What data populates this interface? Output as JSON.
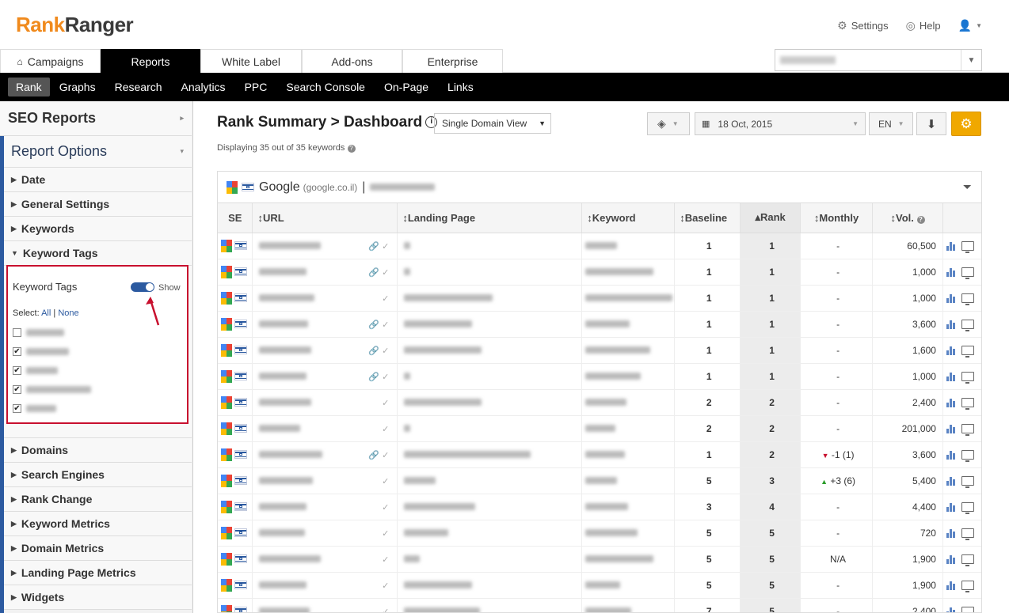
{
  "app": {
    "logo_part1": "Rank",
    "logo_part2": "Ranger",
    "settings": "Settings",
    "help": "Help"
  },
  "tabs": [
    "Campaigns",
    "Reports",
    "White Label",
    "Add-ons",
    "Enterprise"
  ],
  "subnav": [
    "Rank",
    "Graphs",
    "Research",
    "Analytics",
    "PPC",
    "Search Console",
    "On-Page",
    "Links"
  ],
  "sidebar": {
    "seo_reports": "SEO Reports",
    "report_options": "Report Options",
    "options_top": [
      "Date",
      "General Settings",
      "Keywords",
      "Keyword Tags"
    ],
    "keyword_tags_panel": {
      "label": "Keyword Tags",
      "toggle_label": "Show",
      "select_label": "Select:",
      "all": "All",
      "none": "None",
      "checkboxes": [
        {
          "checked": false,
          "w": 48
        },
        {
          "checked": true,
          "w": 54
        },
        {
          "checked": true,
          "w": 40
        },
        {
          "checked": true,
          "w": 82
        },
        {
          "checked": true,
          "w": 38
        }
      ]
    },
    "options_bottom": [
      "Domains",
      "Search Engines",
      "Rank Change",
      "Keyword Metrics",
      "Domain Metrics",
      "Landing Page Metrics",
      "Widgets"
    ]
  },
  "main": {
    "title": "Rank Summary > Dashboard",
    "view_select": "Single Domain View",
    "displaying": "Displaying 35 out of 35 keywords",
    "date": "18 Oct, 2015",
    "lang": "EN",
    "engine": "Google",
    "engine_domain": "(google.co.il)",
    "columns": [
      "SE",
      "URL",
      "Landing Page",
      "Keyword",
      "Baseline",
      "Rank",
      "Monthly",
      "Vol."
    ],
    "rows": [
      {
        "baseline": "1",
        "rank": "1",
        "monthly": "-",
        "vol": "60,500",
        "link": true
      },
      {
        "baseline": "1",
        "rank": "1",
        "monthly": "-",
        "vol": "1,000",
        "link": true
      },
      {
        "baseline": "1",
        "rank": "1",
        "monthly": "-",
        "vol": "1,000",
        "link": false
      },
      {
        "baseline": "1",
        "rank": "1",
        "monthly": "-",
        "vol": "3,600",
        "link": true
      },
      {
        "baseline": "1",
        "rank": "1",
        "monthly": "-",
        "vol": "1,600",
        "link": true
      },
      {
        "baseline": "1",
        "rank": "1",
        "monthly": "-",
        "vol": "1,000",
        "link": true
      },
      {
        "baseline": "2",
        "rank": "2",
        "monthly": "-",
        "vol": "2,400",
        "link": false
      },
      {
        "baseline": "2",
        "rank": "2",
        "monthly": "-",
        "vol": "201,000",
        "link": false
      },
      {
        "baseline": "1",
        "rank": "2",
        "monthly": "-1 (1)",
        "trend": "down",
        "vol": "3,600",
        "link": true
      },
      {
        "baseline": "5",
        "rank": "3",
        "monthly": "+3 (6)",
        "trend": "up",
        "vol": "5,400",
        "link": false
      },
      {
        "baseline": "3",
        "rank": "4",
        "monthly": "-",
        "vol": "4,400",
        "link": false
      },
      {
        "baseline": "5",
        "rank": "5",
        "monthly": "-",
        "vol": "720",
        "link": false
      },
      {
        "baseline": "5",
        "rank": "5",
        "monthly": "N/A",
        "vol": "1,900",
        "link": false
      },
      {
        "baseline": "5",
        "rank": "5",
        "monthly": "-",
        "vol": "1,900",
        "link": false
      },
      {
        "baseline": "7",
        "rank": "5",
        "monthly": "-",
        "vol": "2,400",
        "link": false
      }
    ]
  }
}
